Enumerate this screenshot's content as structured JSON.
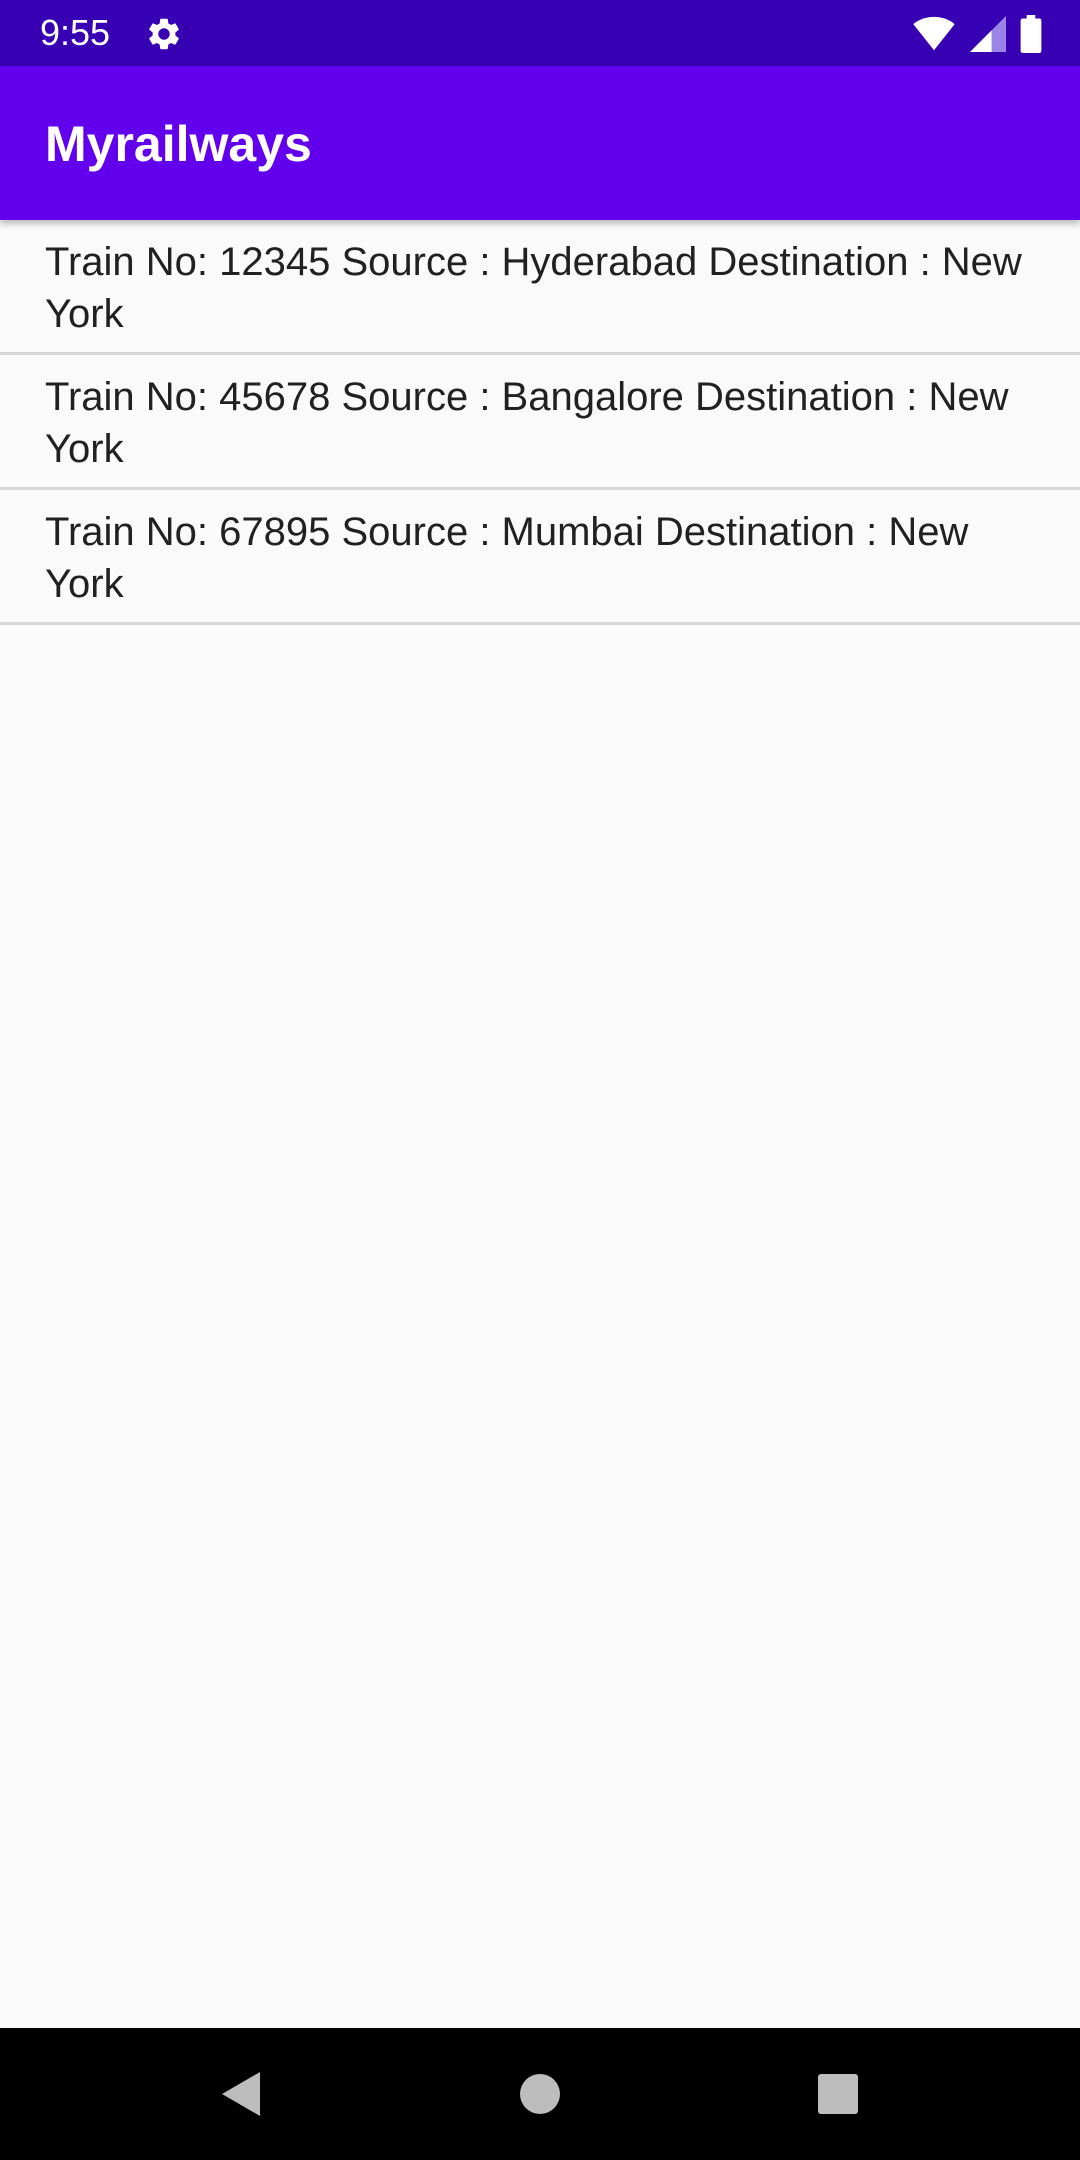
{
  "status_bar": {
    "time": "9:55",
    "icons": [
      "gear-icon",
      "wifi-icon",
      "cell-signal-icon",
      "battery-icon"
    ]
  },
  "app_bar": {
    "title": "Myrailways",
    "color": "#6200ee"
  },
  "trains": [
    {
      "text": "Train No: 12345 Source : Hyderabad  Destination : New York"
    },
    {
      "text": "Train No: 45678 Source : Bangalore  Destination : New York"
    },
    {
      "text": "Train No: 67895 Source : Mumbai  Destination : New York"
    }
  ],
  "nav_bar": {
    "icons": [
      "back-icon",
      "home-icon",
      "recents-icon"
    ]
  }
}
